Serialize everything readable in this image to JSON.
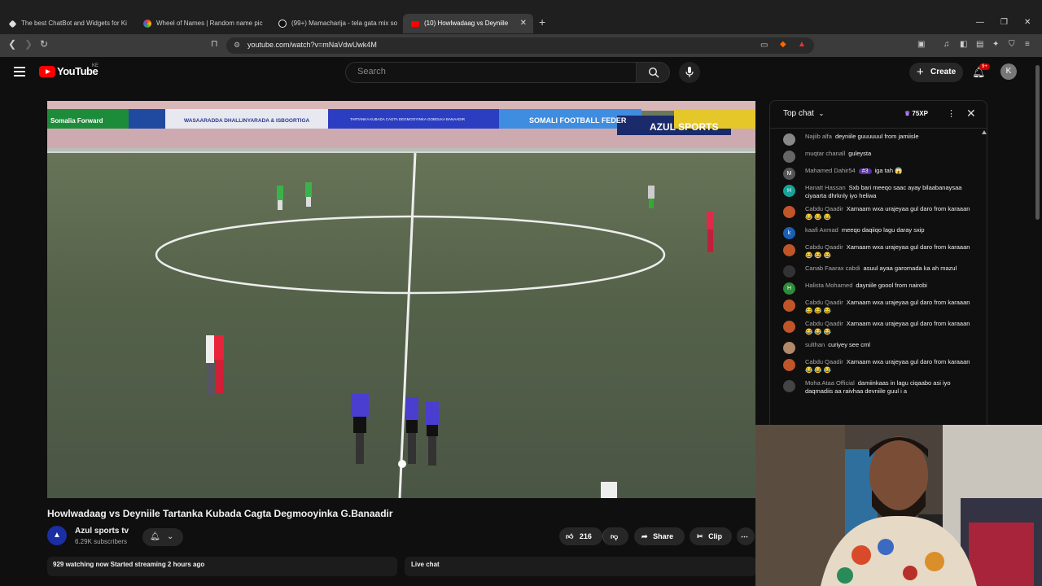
{
  "browser": {
    "tabs": [
      {
        "title": "The best ChatBot and Widgets for Ki",
        "active": false
      },
      {
        "title": "Wheel of Names | Random name pic",
        "active": false
      },
      {
        "title": "(99+) Mamacharija - tela gata mix so",
        "active": false
      },
      {
        "title": "(10) Howlwadaag vs Deyniile",
        "active": true
      }
    ],
    "url": "youtube.com/watch?v=mNaVdwUwk4M"
  },
  "header": {
    "logo_text": "YouTube",
    "country": "KE",
    "search_placeholder": "Search",
    "create_label": "Create",
    "notifications": "9+",
    "avatar_letter": "K"
  },
  "video": {
    "title": "Howlwadaag vs Deyniile Tartanka Kubada Cagta Degmooyinka G.Banaadir",
    "banner_texts": [
      "Somalia Forward",
      "WASAARADDA DHALLINYARADA & ISBOORTIGA",
      "TARTANKA KUBADA CAGTA DEGMOOYINKA GOBOLKA BANAADIR",
      "SOMALI FOOTBALL FEDER",
      "AZUL SPORTS"
    ]
  },
  "channel": {
    "name": "Azul sports tv",
    "subscribers": "6.29K subscribers",
    "avatar_glyph": "▲"
  },
  "actions": {
    "likes": "216",
    "share": "Share",
    "clip": "Clip"
  },
  "description": {
    "stats": "929 watching now  Started streaming 2 hours ago"
  },
  "livechat": {
    "bar_label": "Live chat",
    "mode": "Top chat",
    "xp": "75XP",
    "messages": [
      {
        "author": "Najiib alfa",
        "text": "deyniile guuuuuul from jamiisle",
        "color": "#888",
        "initial": ""
      },
      {
        "author": "muqtar chanall",
        "text": "guleysta",
        "color": "#666",
        "initial": ""
      },
      {
        "author": "Mahamed Dahir54",
        "text": "iga tah 😱",
        "color": "#555",
        "initial": "M",
        "badge": "#3"
      },
      {
        "author": "Hanatt Hassan",
        "text": "Sxb bari meeqo saac ayay bilaabanaysaa ciyaarta dhrknly iyo heliwa",
        "color": "#17a398",
        "initial": "H"
      },
      {
        "author": "Cabdu Qaadir",
        "text": "Xamaam wxa urajeyaa gul daro from karaaan 😂 😂 😂",
        "color": "#c0552a",
        "initial": ""
      },
      {
        "author": "kaafi Axmad",
        "text": "meeqo daqiiqo lagu daray sxip",
        "color": "#1a5fb4",
        "initial": "k"
      },
      {
        "author": "Cabdu Qaadir",
        "text": "Xamaam wxa urajeyaa gul daro from karaaan 😂 😂 😂",
        "color": "#c0552a",
        "initial": ""
      },
      {
        "author": "Canab Faarax cabdi",
        "text": "asuul ayaa garomada ka ah mazul",
        "color": "#333",
        "initial": ""
      },
      {
        "author": "Halista Mohamed",
        "text": "dayniile goool from nairobi",
        "color": "#2e8b3a",
        "initial": "H"
      },
      {
        "author": "Cabdu Qaadir",
        "text": "Xamaam wxa urajeyaa gul daro from karaaan 😂 😂 😂",
        "color": "#c0552a",
        "initial": ""
      },
      {
        "author": "Cabdu Qaadir",
        "text": "Xamaam wxa urajeyaa gul daro from karaaan 😂 😂 😂",
        "color": "#c0552a",
        "initial": ""
      },
      {
        "author": "sulthan",
        "text": "curiyey see cml",
        "color": "#b08a6a",
        "initial": ""
      },
      {
        "author": "Cabdu Qaadir",
        "text": "Xamaam wxa urajeyaa gul daro from karaaan 😂 😂 😂",
        "color": "#c0552a",
        "initial": ""
      },
      {
        "author": "Moha Ataa Official",
        "text": "damiinkaas in lagu ciqaabo asi iyo daqmadiis aa raivhaa devniile guul i a",
        "color": "#444",
        "initial": ""
      }
    ]
  },
  "icons": {
    "back": "arrow-left-icon",
    "forward": "arrow-right-icon",
    "reload": "reload-icon",
    "search": "search-icon",
    "mic": "mic-icon",
    "bell": "bell-icon",
    "like": "thumbs-up-icon",
    "dislike": "thumbs-down-icon"
  }
}
